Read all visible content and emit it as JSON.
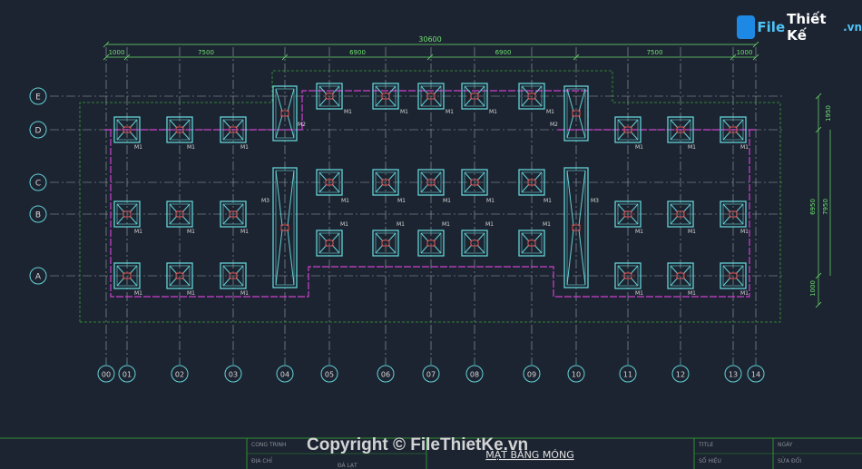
{
  "overall_dimension": "30600",
  "bay_dimensions": [
    "1000",
    "7500",
    "6900",
    "6900",
    "7500",
    "1000"
  ],
  "side_dimensions": [
    "1950",
    "6950",
    "7950",
    "1000"
  ],
  "row_axes": [
    "E",
    "D",
    "C",
    "B",
    "A"
  ],
  "column_axes": [
    "00",
    "01",
    "02",
    "03",
    "04",
    "05",
    "06",
    "07",
    "08",
    "09",
    "10",
    "11",
    "12",
    "13",
    "14"
  ],
  "footing_types": {
    "m1": "M1",
    "m2": "M2",
    "m3": "M3"
  },
  "title_block": {
    "cong_trinh": "CONG TRINH",
    "dia_chi": "ĐỊA CHỈ",
    "location": "ĐÀ LẠT",
    "drawing_title": "MẶT BẰNG MÓNG",
    "title_label": "TITLE",
    "so_hieu": "SỐ HIỆU",
    "ngay": "NGÀY",
    "sua_doi": "SỬA ĐỔI"
  },
  "logo": {
    "part1": "File",
    "part2": "Thiết Kế",
    "part3": ".vn"
  },
  "watermark": "Copyright © FileThietKe.vn",
  "colors": {
    "background": "#1c2431",
    "grid": "#9aa3ad",
    "dimension": "#6ee06e",
    "footing": "#64d2d6",
    "beam": "#d040d0",
    "pedestal": "#e05050",
    "outline": "#3ba03b",
    "bubble": "#64d2d6",
    "frame": "#2f8f2f"
  }
}
